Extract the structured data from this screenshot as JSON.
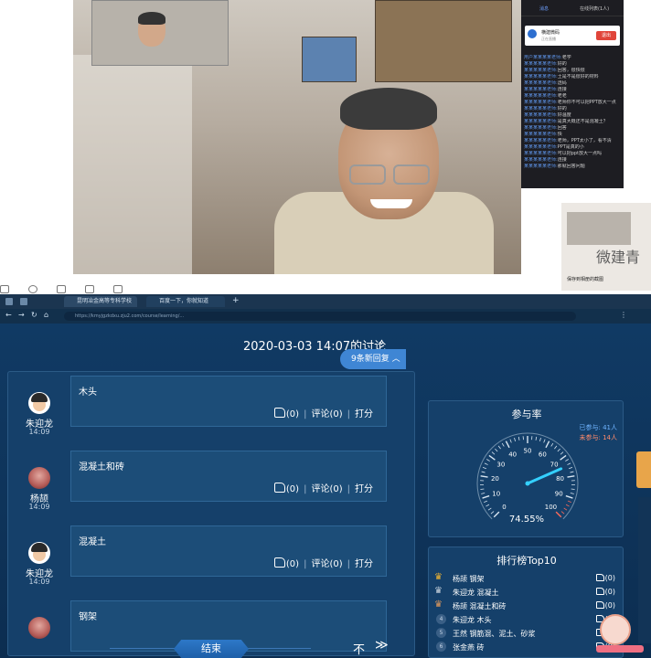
{
  "chat_overlay": {
    "tab_left": "消息",
    "tab_right": "在线列表(1人)",
    "notice_title": "横建微码",
    "notice_sub": "正在直播",
    "notice_button": "退出",
    "lines": [
      {
        "user": "用户某某某某老师:",
        "text": "老学"
      },
      {
        "user": "某某某某某老师:",
        "text": "好的"
      },
      {
        "user": "某某某某某老师:",
        "text": "回答，很快很"
      },
      {
        "user": "某某某某某老师:",
        "text": "土是不是很好的材料"
      },
      {
        "user": "某某某某某老师:",
        "text": "透码"
      },
      {
        "user": "某某某某某老师:",
        "text": "连接"
      },
      {
        "user": "某某某某某老师:",
        "text": "老老"
      },
      {
        "user": "某某某某某老师:",
        "text": "老师你不可以把PPT放大一点"
      },
      {
        "user": "某某某某某老师:",
        "text": "好的"
      },
      {
        "user": "某某某某某老师:",
        "text": "好温度"
      },
      {
        "user": "某某某某某老师:",
        "text": "是真大概还不是混凝土？"
      },
      {
        "user": "某某某某某老师:",
        "text": "回答"
      },
      {
        "user": "某某某某某老师:",
        "text": "快"
      },
      {
        "user": "某某某某某老师:",
        "text": "老师，PPT太小了，看不清"
      },
      {
        "user": "某某某某某老师:",
        "text": "PPT是真的小"
      },
      {
        "user": "某某某某某老师:",
        "text": "可以把ppt放大一点吗"
      },
      {
        "user": "某某某某某老师:",
        "text": "连接"
      },
      {
        "user": "某某某某某老师:",
        "text": "那就回答问题"
      }
    ]
  },
  "thumb_right": {
    "watermark_text": "微建青",
    "caption": "保存到相册的截图"
  },
  "browser": {
    "tab1_label": "昆明冶金高等专科学校",
    "tab2_label": "百度一下，你就知道",
    "url": "https://kmyjgzkdxu.zju2.com/course/learning/..."
  },
  "page": {
    "discussion_title": "2020-03-03 14:07的讨论",
    "new_replies_label": "9条新回复",
    "end_button": "结束",
    "bottom_glyph": "不",
    "bottom_forward": "≫",
    "posts": [
      {
        "name": "朱迎龙",
        "time": "14:09",
        "text": "木头",
        "likes": "(0)",
        "comment": "评论(0)",
        "score": "打分"
      },
      {
        "name": "杨颉",
        "time": "14:09",
        "text": "混凝土和砖",
        "likes": "(0)",
        "comment": "评论(0)",
        "score": "打分"
      },
      {
        "name": "朱迎龙",
        "time": "14:09",
        "text": "混凝土",
        "likes": "(0)",
        "comment": "评论(0)",
        "score": "打分"
      },
      {
        "name": "",
        "time": "",
        "text": "钢架",
        "likes": "",
        "comment": "",
        "score": ""
      }
    ],
    "participation": {
      "title": "参与率",
      "joined": "已参与: 41人",
      "not_joined": "未参与: 14人",
      "percent_label": "74.55%",
      "percent_value": 74.55,
      "ticks": [
        "0",
        "10",
        "20",
        "30",
        "40",
        "50",
        "60",
        "70",
        "80",
        "90",
        "100"
      ]
    },
    "ranking": {
      "title": "排行榜Top10",
      "rows": [
        {
          "rank": "1",
          "text": "杨颉 钢架",
          "likes": "(0)"
        },
        {
          "rank": "2",
          "text": "朱迎龙 混凝土",
          "likes": "(0)"
        },
        {
          "rank": "3",
          "text": "杨颉 混凝土和砖",
          "likes": "(0)"
        },
        {
          "rank": "4",
          "text": "朱迎龙 木头",
          "likes": "(0)"
        },
        {
          "rank": "5",
          "text": "王然 钢筋混、泥土、砂浆",
          "likes": "(0)"
        },
        {
          "rank": "6",
          "text": "张金燕 砖",
          "likes": "(0)"
        }
      ]
    }
  },
  "colors": {
    "accent_blue": "#3f86d4",
    "gauge_needle": "#34d0ff",
    "crown_gold": "#f2b632",
    "page_bg": "#0e3359"
  }
}
